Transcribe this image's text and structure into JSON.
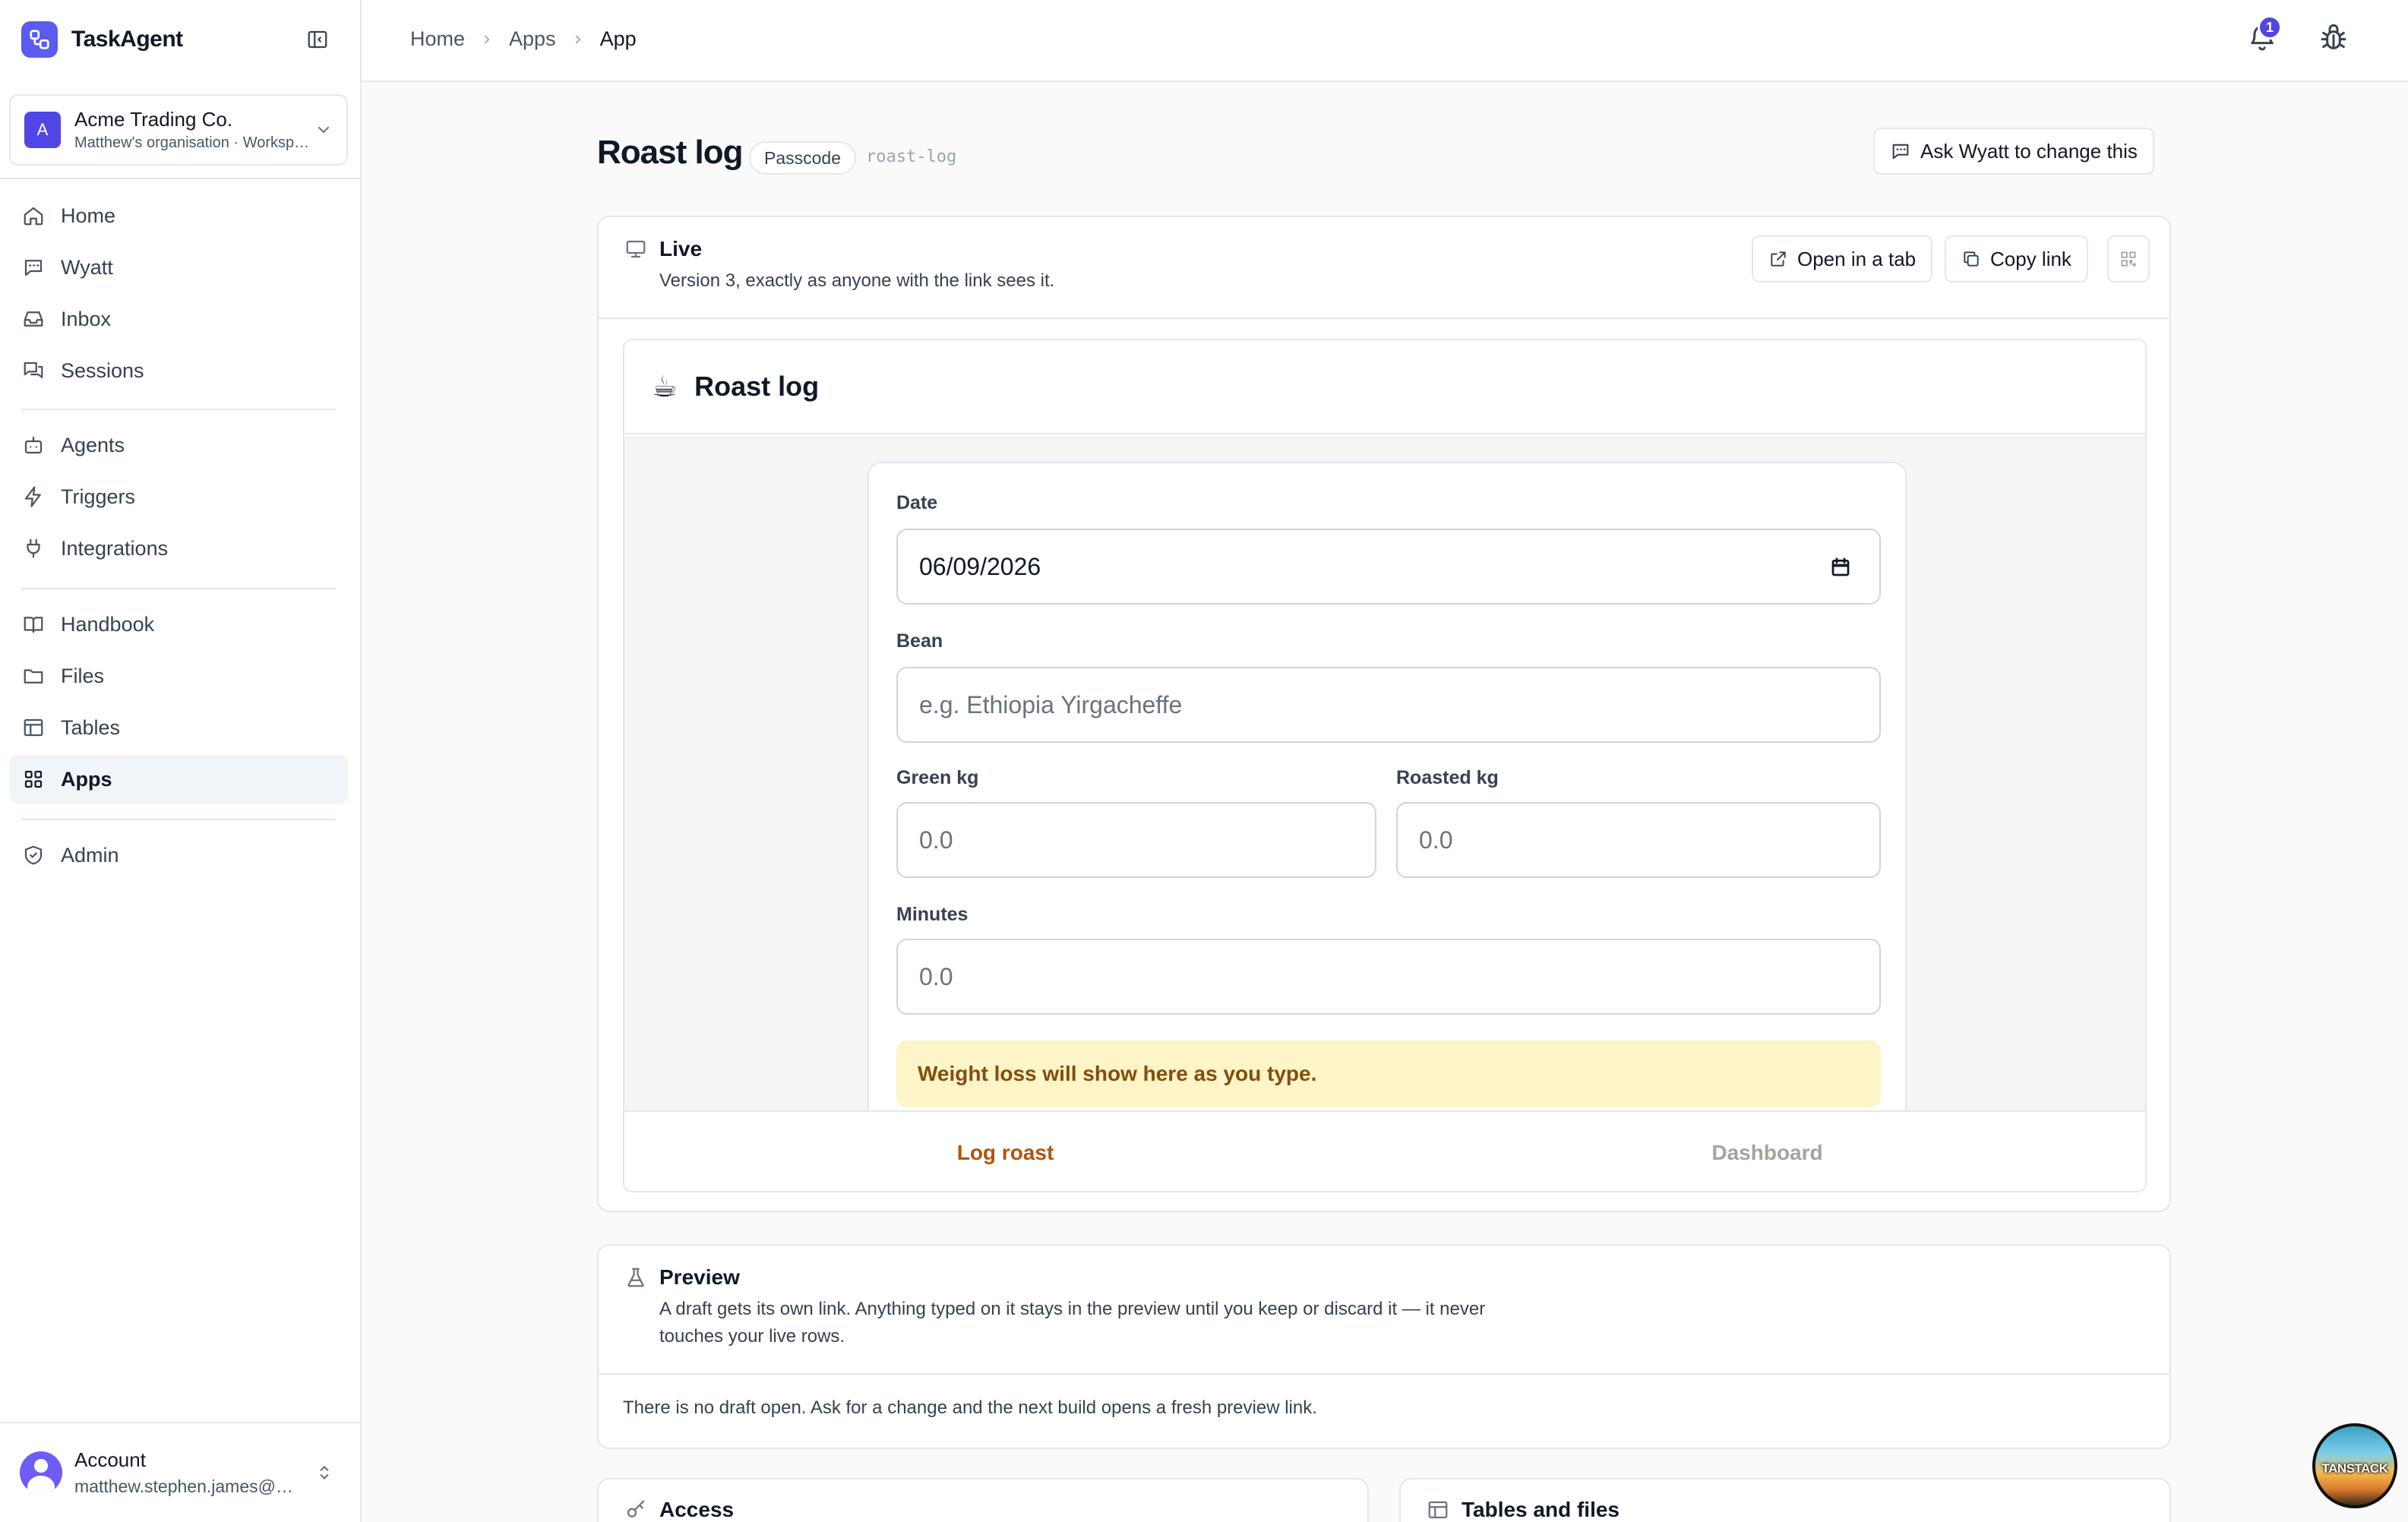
{
  "brand": {
    "name": "TaskAgent"
  },
  "org": {
    "initial": "A",
    "name": "Acme Trading Co.",
    "subtitle": "Matthew's organisation · Workspace"
  },
  "nav": {
    "home": "Home",
    "wyatt": "Wyatt",
    "inbox": "Inbox",
    "sessions": "Sessions",
    "agents": "Agents",
    "triggers": "Triggers",
    "integrations": "Integrations",
    "handbook": "Handbook",
    "files": "Files",
    "tables": "Tables",
    "apps": "Apps",
    "admin": "Admin"
  },
  "account": {
    "label": "Account",
    "email": "matthew.stephen.james@example.com"
  },
  "breadcrumb": {
    "home": "Home",
    "apps": "Apps",
    "current": "App"
  },
  "notifications": {
    "count": "1"
  },
  "page": {
    "title": "Roast log",
    "badge": "Passcode",
    "slug": "roast-log",
    "ask_button": "Ask Wyatt to change this"
  },
  "live": {
    "title": "Live",
    "subtitle": "Version 3, exactly as anyone with the link sees it.",
    "open_tab": "Open in a tab",
    "copy_link": "Copy link"
  },
  "app": {
    "emoji": "☕",
    "title": "Roast log",
    "date_label": "Date",
    "date_value": "06/09/2026",
    "bean_label": "Bean",
    "bean_placeholder": "e.g. Ethiopia Yirgacheffe",
    "green_label": "Green kg",
    "green_placeholder": "0.0",
    "roasted_label": "Roasted kg",
    "roasted_placeholder": "0.0",
    "minutes_label": "Minutes",
    "minutes_placeholder": "0.0",
    "notice": "Weight loss will show here as you type.",
    "tab_log": "Log roast",
    "tab_dashboard": "Dashboard"
  },
  "preview": {
    "title": "Preview",
    "desc_line1": "A draft gets its own link. Anything typed on it stays in the preview until you keep or discard it — it never",
    "desc_line2": "touches your live rows.",
    "empty": "There is no draft open. Ask for a change and the next build opens a fresh preview link."
  },
  "sections": {
    "access": "Access",
    "tables_files": "Tables and files"
  },
  "badge": {
    "tanstack": "TANSTACK"
  },
  "colors": {
    "accent": "#5b5bf0",
    "active_tab": "#b45309",
    "notice_bg": "#fdf4c8",
    "notice_text": "#854d0e"
  }
}
